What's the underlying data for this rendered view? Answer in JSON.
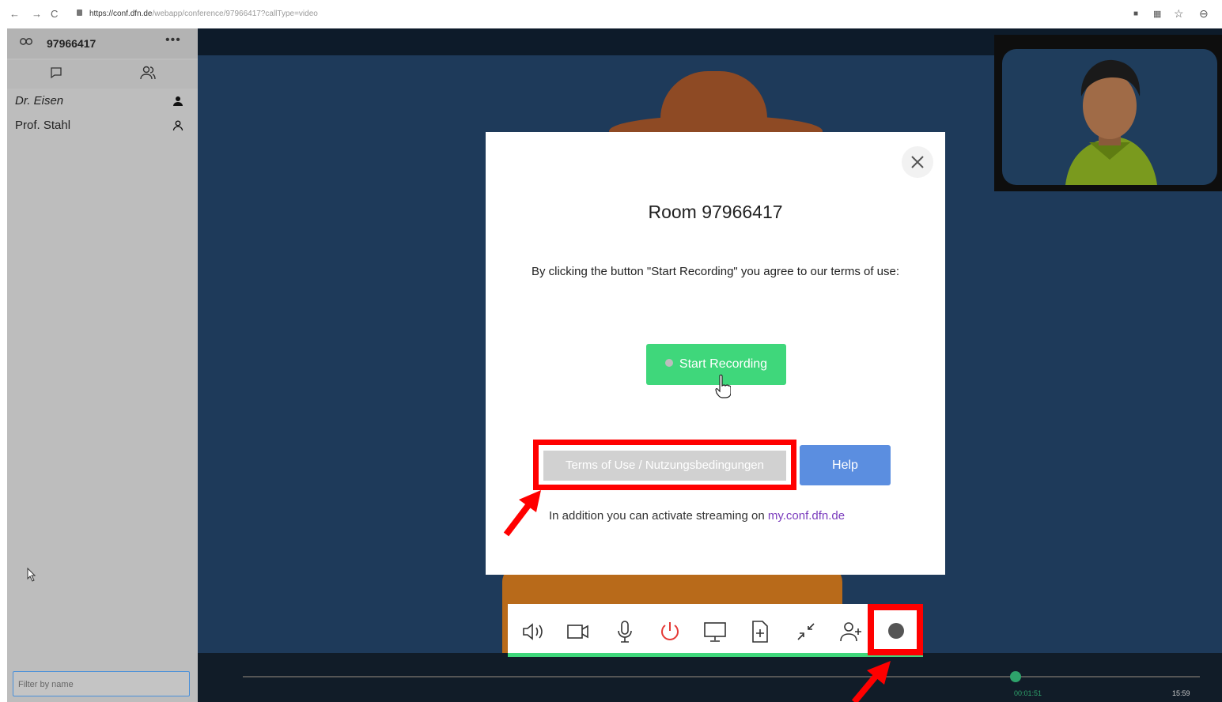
{
  "browser": {
    "url_host": "https://conf.dfn.de",
    "url_path": "/webapp/conference/97966417?callType=video"
  },
  "sidebar": {
    "room_id": "97966417",
    "more_label": "•••",
    "participants": [
      {
        "name": "Dr. Eisen"
      },
      {
        "name": "Prof. Stahl"
      }
    ],
    "filter_placeholder": "Filter by name"
  },
  "modal": {
    "title": "Room 97966417",
    "agreement_text": "By clicking the button \"Start Recording\" you agree to our terms of use:",
    "start_recording_label": "Start Recording",
    "terms_label": "Terms of Use / Nutzungsbedingungen",
    "help_label": "Help",
    "streaming_text": "In addition you can activate streaming on ",
    "streaming_link": "my.conf.dfn.de"
  },
  "toolbar": {
    "icons": [
      "speaker-icon",
      "camera-icon",
      "microphone-icon",
      "power-icon",
      "screen-share-icon",
      "add-file-icon",
      "minimize-icon",
      "add-person-icon",
      "record-icon"
    ]
  },
  "timeline": {
    "current_time": "00:01:51",
    "end_time": "15:59"
  },
  "colors": {
    "accent_green": "#3fd77b",
    "help_blue": "#5b8ee0",
    "highlight_red": "#ff0000",
    "link_purple": "#7a3bbd"
  }
}
